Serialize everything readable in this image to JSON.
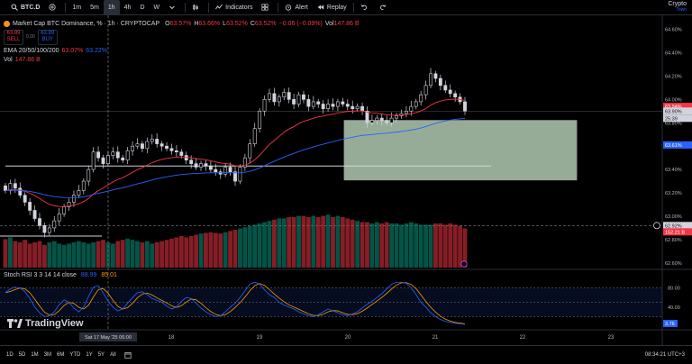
{
  "topbar": {
    "symbol": "BTC.D",
    "intervals": [
      "1m",
      "5m",
      "1h",
      "4h",
      "D",
      "W"
    ],
    "active_interval": "1h",
    "indicators_label": "Indicators",
    "alert_label": "Alert",
    "replay_label": "Replay"
  },
  "brand": {
    "line1": "Crypto",
    "line2": "Town"
  },
  "legend": {
    "title": "Market Cap BTC Dominance, % · 1h · CRYPTOCAP",
    "o_label": "O",
    "o": "63.57%",
    "h_label": "H",
    "h": "63.66%",
    "l_label": "L",
    "l": "63.52%",
    "c_label": "C",
    "c": "63.52%",
    "change": "−0.06 (−0.09%)",
    "vol_label": "Vol",
    "vol": "147.86 B",
    "sell_price": "63.89",
    "sell_label": "SELL",
    "spread": "0.00",
    "buy_price": "63.89",
    "buy_label": "BUY",
    "ema_label": "EMA 20/50/100/200",
    "ema_v1": "63.07%",
    "ema_v2": "63.22%",
    "vol_row_label": "Vol",
    "vol_row_value": "147.86 B",
    "rsi_label": "Stoch RSI 3 3 14 14 close",
    "rsi_k": "88.99",
    "rsi_d": "85.01"
  },
  "colors": {
    "up": "#089981",
    "down": "#f23645",
    "ema_fast": "#f23645",
    "ema_slow": "#2962ff",
    "rsi_k": "#2962ff",
    "rsi_d": "#ff9800",
    "zone": "#c8e6c9"
  },
  "price_axis": {
    "ticks": [
      "64.60%",
      "64.40%",
      "64.20%",
      "64.00%",
      "63.80%",
      "63.60%",
      "63.40%",
      "63.20%",
      "63.00%",
      "62.80%",
      "62.60%"
    ],
    "labels": [
      {
        "text": "63.94%",
        "color": "#f23645"
      },
      {
        "text": "63.90%",
        "color": "#131722"
      },
      {
        "text": "25:39",
        "color": "#131722"
      },
      {
        "text": "63.61%",
        "color": "#2962ff"
      },
      {
        "text": "62.92%",
        "color": "#131722"
      },
      {
        "text": "152.21 B",
        "color": "#f23645"
      }
    ]
  },
  "rsi_axis": {
    "ticks": [
      "80.00",
      "40.00"
    ],
    "current": "3.76"
  },
  "time_axis": {
    "ticks": [
      "18",
      "19",
      "20",
      "21",
      "22",
      "23"
    ],
    "crosshair_label": "Sat 17 May '25   06:00"
  },
  "logo_text": "TradingView",
  "bottombar": {
    "ranges": [
      "1D",
      "5D",
      "1M",
      "3M",
      "6M",
      "YTD",
      "1Y",
      "5Y",
      "All"
    ],
    "clock": "08:34:21 UTC+3"
  },
  "chart_data": {
    "type": "candlestick",
    "closes": [
      63.22,
      63.28,
      63.24,
      63.18,
      63.12,
      63.05,
      62.98,
      62.92,
      62.86,
      62.9,
      62.96,
      63.02,
      63.08,
      63.12,
      63.18,
      63.22,
      63.3,
      63.4,
      63.55,
      63.5,
      63.45,
      63.52,
      63.55,
      63.5,
      63.48,
      63.56,
      63.6,
      63.62,
      63.58,
      63.64,
      63.66,
      63.62,
      63.6,
      63.58,
      63.56,
      63.55,
      63.52,
      63.48,
      63.45,
      63.42,
      63.45,
      63.43,
      63.4,
      63.38,
      63.36,
      63.42,
      63.38,
      63.3,
      63.42,
      63.5,
      63.62,
      63.75,
      63.9,
      64.0,
      64.05,
      63.98,
      64.02,
      64.06,
      64.0,
      63.96,
      64.04,
      64.0,
      63.94,
      63.98,
      63.96,
      63.92,
      63.96,
      63.94,
      63.98,
      63.96,
      63.94,
      63.92,
      63.94,
      63.9,
      63.8,
      63.82,
      63.84,
      63.82,
      63.8,
      63.84,
      63.86,
      63.88,
      63.9,
      63.94,
      63.98,
      64.04,
      64.12,
      64.22,
      64.18,
      64.12,
      64.08,
      64.05,
      64.02,
      63.98,
      63.9
    ],
    "volumes": [
      0.45,
      0.48,
      0.42,
      0.4,
      0.44,
      0.38,
      0.4,
      0.42,
      0.36,
      0.4,
      0.42,
      0.38,
      0.36,
      0.38,
      0.4,
      0.42,
      0.4,
      0.38,
      0.4,
      0.42,
      0.44,
      0.4,
      0.38,
      0.42,
      0.44,
      0.46,
      0.44,
      0.42,
      0.4,
      0.42,
      0.38,
      0.4,
      0.42,
      0.44,
      0.46,
      0.48,
      0.5,
      0.48,
      0.5,
      0.52,
      0.54,
      0.55,
      0.56,
      0.55,
      0.54,
      0.56,
      0.58,
      0.6,
      0.62,
      0.64,
      0.66,
      0.68,
      0.7,
      0.72,
      0.74,
      0.76,
      0.78,
      0.78,
      0.8,
      0.8,
      0.82,
      0.82,
      0.8,
      0.82,
      0.8,
      0.82,
      0.84,
      0.8,
      0.82,
      0.8,
      0.78,
      0.76,
      0.74,
      0.72,
      0.72,
      0.7,
      0.72,
      0.7,
      0.72,
      0.7,
      0.7,
      0.68,
      0.7,
      0.72,
      0.7,
      0.68,
      0.68,
      0.68,
      0.7,
      0.7,
      0.68,
      0.7,
      0.68,
      0.66,
      0.62
    ],
    "stoch_k": [
      70,
      78,
      82,
      80,
      72,
      58,
      40,
      28,
      20,
      22,
      30,
      45,
      55,
      50,
      38,
      30,
      40,
      62,
      82,
      85,
      70,
      52,
      40,
      32,
      36,
      48,
      60,
      70,
      72,
      66,
      58,
      54,
      50,
      42,
      36,
      40,
      52,
      60,
      58,
      48,
      38,
      30,
      24,
      20,
      22,
      30,
      40,
      48,
      60,
      74,
      88,
      92,
      88,
      76,
      66,
      60,
      50,
      44,
      40,
      36,
      30,
      26,
      22,
      20,
      24,
      30,
      36,
      32,
      28,
      24,
      22,
      26,
      30,
      38,
      46,
      52,
      60,
      68,
      78,
      88,
      92,
      92,
      90,
      80,
      66,
      50,
      40,
      28,
      20,
      14,
      10,
      8,
      6,
      5,
      4
    ]
  }
}
